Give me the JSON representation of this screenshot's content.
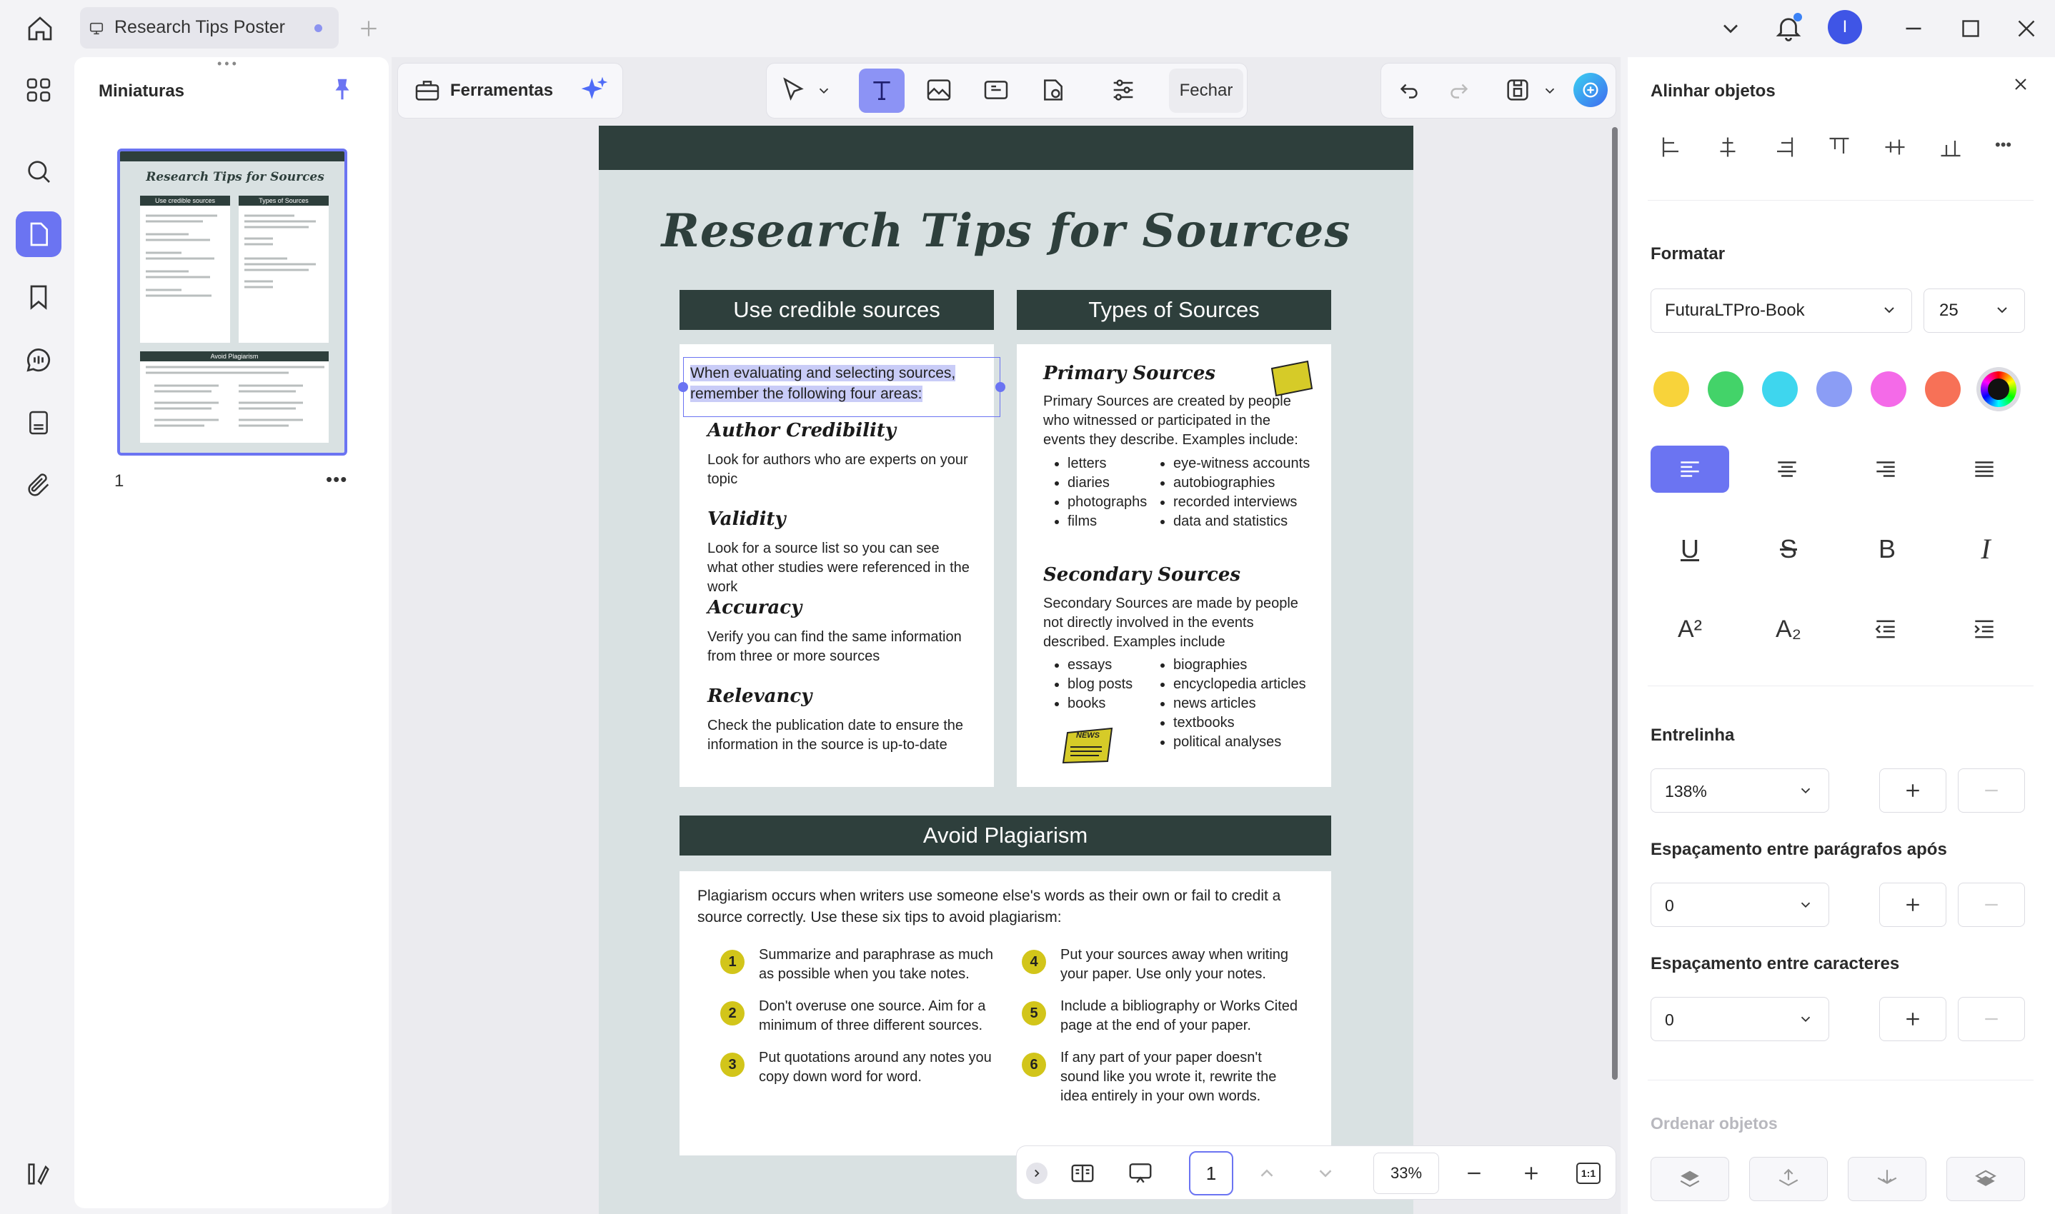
{
  "tab": {
    "title": "Research Tips Poster"
  },
  "panel": {
    "title": "Miniaturas",
    "page_number": "1"
  },
  "toolbar": {
    "tools_label": "Ferramentas",
    "close_label": "Fechar"
  },
  "poster": {
    "title": "Research Tips for Sources",
    "credible": {
      "header": "Use credible sources",
      "intro": "When evaluating and selecting sources, remember the following four areas:",
      "items": [
        {
          "heading": "Author Credibility",
          "text": "Look for authors who are experts on your topic"
        },
        {
          "heading": "Validity",
          "text": "Look for a source list so you can see what other studies were referenced in the work"
        },
        {
          "heading": "Accuracy",
          "text": "Verify you can find the same information from three or more sources"
        },
        {
          "heading": "Relevancy",
          "text": "Check the publication date to ensure the information in the source is up-to-date"
        }
      ]
    },
    "types": {
      "header": "Types of Sources",
      "primary": {
        "heading": "Primary Sources",
        "text": "Primary Sources are created by people who witnessed or participated in the events they describe. Examples include:",
        "col1": [
          "letters",
          "diaries",
          "photographs",
          "films"
        ],
        "col2": [
          "eye-witness accounts",
          "autobiographies",
          "recorded interviews",
          "data and statistics"
        ]
      },
      "secondary": {
        "heading": "Secondary Sources",
        "text": "Secondary Sources are made by people not directly involved in the events described. Examples include",
        "col1": [
          "essays",
          "blog posts",
          "books"
        ],
        "col2": [
          "biographies",
          "encyclopedia articles",
          "news articles",
          "textbooks",
          "political analyses"
        ]
      },
      "news_icon_text": "NEWS"
    },
    "plagiarism": {
      "header": "Avoid Plagiarism",
      "intro": "Plagiarism occurs when writers use someone else's words as their own or fail to credit a source correctly. Use these six tips to avoid plagiarism:",
      "tips": [
        {
          "n": "1",
          "text": "Summarize and paraphrase as much as possible when you take notes."
        },
        {
          "n": "2",
          "text": "Don't overuse one source. Aim for a minimum of three different sources."
        },
        {
          "n": "3",
          "text": "Put quotations around any notes you copy down word for word."
        },
        {
          "n": "4",
          "text": "Put your sources away when writing your paper. Use only your notes."
        },
        {
          "n": "5",
          "text": "Include a bibliography or Works Cited page at the end of your paper."
        },
        {
          "n": "6",
          "text": "If any part of your paper doesn't sound like you wrote it, rewrite the idea entirely in your own words."
        }
      ]
    }
  },
  "bottombar": {
    "page": "1",
    "zoom": "33%",
    "actual_size": "1:1"
  },
  "right_panel": {
    "align_title": "Alinhar objetos",
    "format_title": "Formatar",
    "font_family": "FuturaLTPro-Book",
    "font_size": "25",
    "colors": [
      "#f8d33a",
      "#43d369",
      "#3ed6ee",
      "#8b9df5",
      "#f46ae8",
      "#f77157"
    ],
    "format_glyphs": {
      "underline": "U",
      "strike": "S",
      "bold": "B",
      "italic": "I",
      "superscript": "A²",
      "subscript": "A₂"
    },
    "line_spacing_label": "Entrelinha",
    "line_spacing_value": "138%",
    "para_spacing_label": "Espaçamento entre parágrafos após",
    "para_spacing_value": "0",
    "char_spacing_label": "Espaçamento entre caracteres",
    "char_spacing_value": "0",
    "order_label": "Ordenar objetos"
  },
  "user": {
    "initial": "I"
  }
}
